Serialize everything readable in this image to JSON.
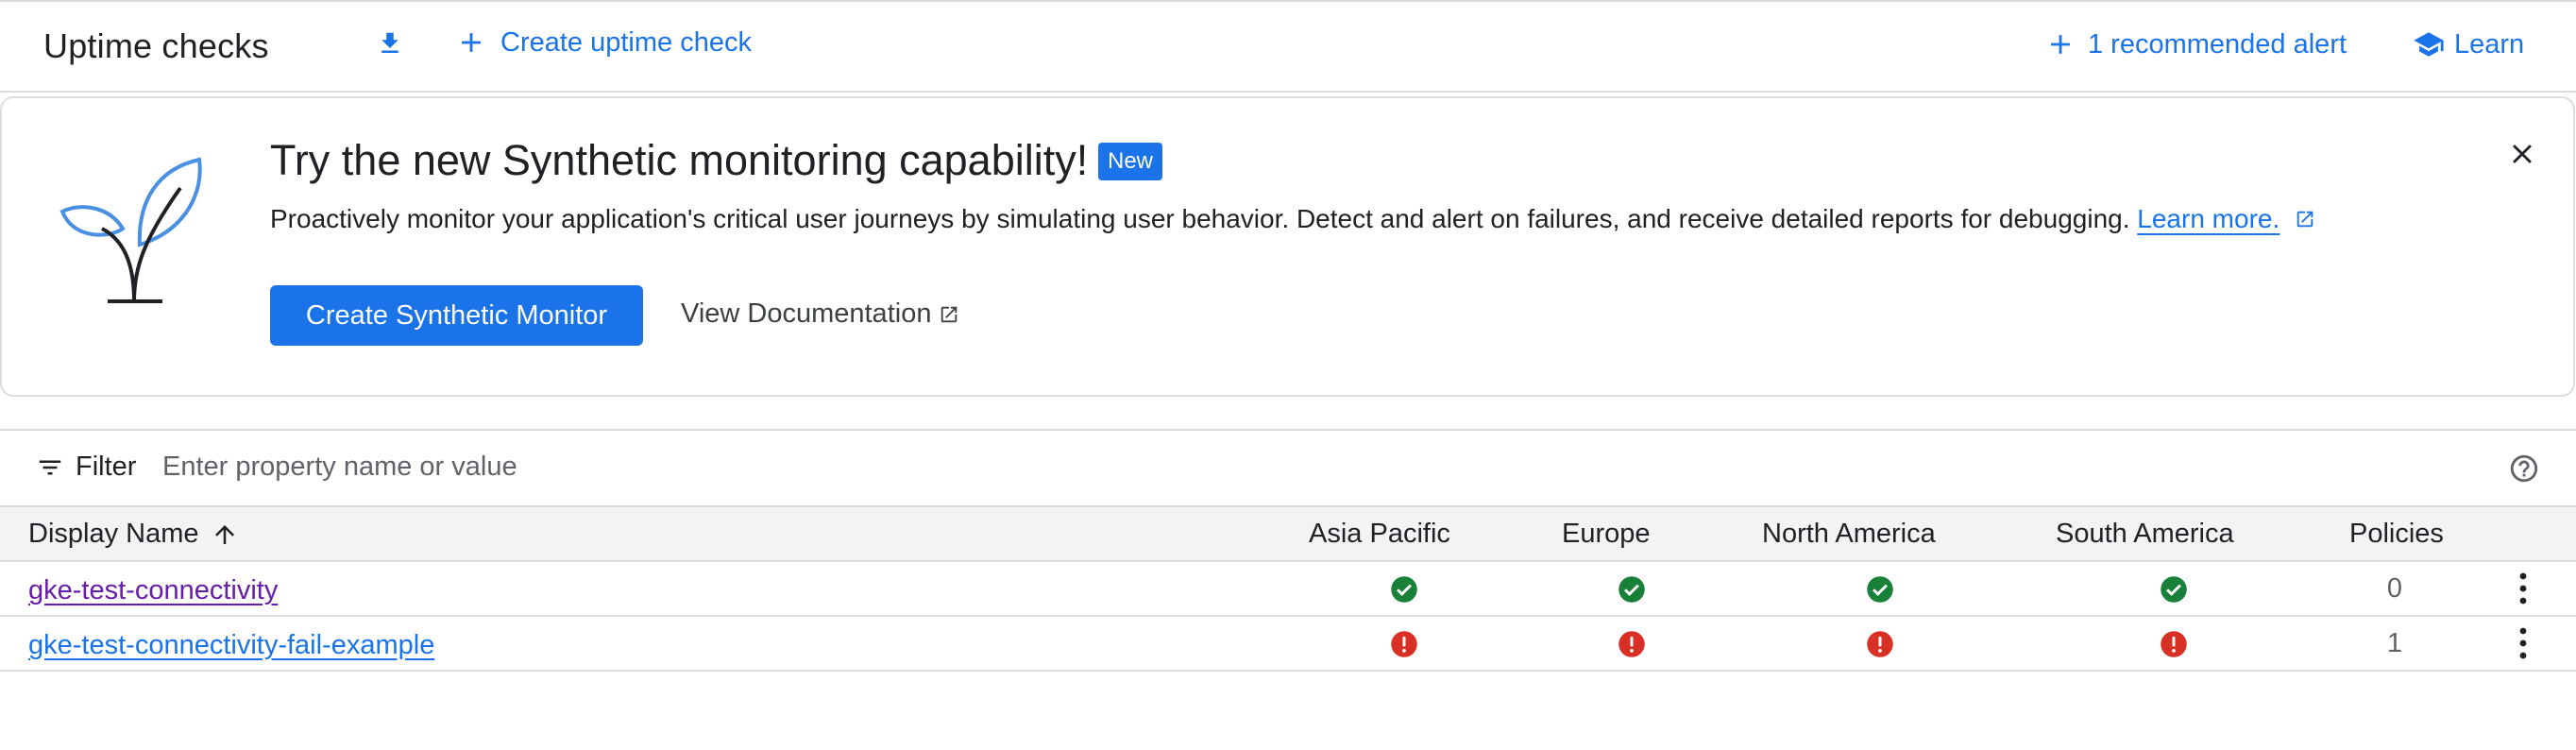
{
  "header": {
    "title": "Uptime checks",
    "create_uptime_label": "Create uptime check",
    "recommended_alert_label": "1 recommended alert",
    "learn_label": "Learn"
  },
  "banner": {
    "title": "Try the new Synthetic monitoring capability!",
    "badge": "New",
    "description": "Proactively monitor your application's critical user journeys by simulating user behavior. Detect and alert on failures, and receive detailed reports for debugging.",
    "learn_more": "Learn more.",
    "primary_button": "Create Synthetic Monitor",
    "secondary_button": "View Documentation"
  },
  "filter": {
    "label": "Filter",
    "placeholder": "Enter property name or value",
    "value": ""
  },
  "table": {
    "columns": {
      "name": "Display Name",
      "asia": "Asia Pacific",
      "europe": "Europe",
      "north_america": "North America",
      "south_america": "South America",
      "policies": "Policies"
    },
    "sort": "ascending",
    "rows": [
      {
        "name": "gke-test-connectivity",
        "asia": "passing",
        "europe": "passing",
        "north_america": "passing",
        "south_america": "passing",
        "policies": "0"
      },
      {
        "name": "gke-test-connectivity-fail-example",
        "asia": "failing",
        "europe": "failing",
        "north_america": "failing",
        "south_america": "failing",
        "policies": "1"
      }
    ]
  },
  "icons": {
    "download": "download-icon",
    "add": "plus-icon",
    "learn": "school-icon",
    "close": "close-icon",
    "external": "open-in-new-icon",
    "filter": "filter-list-icon",
    "help": "help-icon",
    "sort": "arrow-upward-icon",
    "more": "more-vert-icon",
    "passing": "check-circle-icon",
    "failing": "error-icon"
  },
  "colors": {
    "accent": "#1a73e8",
    "success": "#188038",
    "error": "#d93025",
    "visited_link": "#681da8"
  }
}
